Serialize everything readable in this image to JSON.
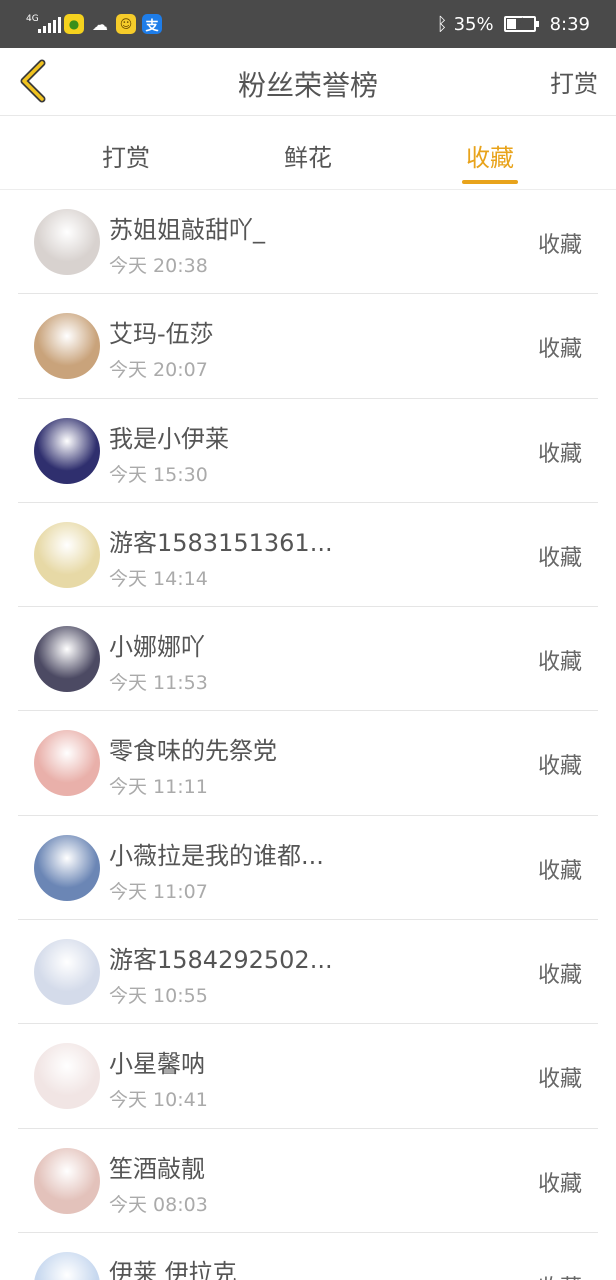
{
  "status_bar": {
    "network": "4G",
    "battery": "35%",
    "battery_level": 0.35,
    "time": "8:39",
    "app_icons": [
      "app-icon",
      "wechat-icon",
      "app-icon",
      "alipay-icon"
    ]
  },
  "header": {
    "title": "粉丝荣誉榜",
    "action": "打赏"
  },
  "tabs": [
    {
      "label": "打赏",
      "active": false
    },
    {
      "label": "鲜花",
      "active": false
    },
    {
      "label": "收藏",
      "active": true
    }
  ],
  "colors": {
    "accent": "#e8a31b",
    "status_bar": "#4a4a4a"
  },
  "fans": [
    {
      "name": "苏姐姐敲甜吖_",
      "time": "今天 20:38",
      "action": "收藏",
      "avatar_color": "#d8d2cf"
    },
    {
      "name": "艾玛-伍莎",
      "time": "今天 20:07",
      "action": "收藏",
      "avatar_color": "#c9a37b"
    },
    {
      "name": "我是小伊莱",
      "time": "今天 15:30",
      "action": "收藏",
      "avatar_color": "#2f2f6e"
    },
    {
      "name": "游客1583151361...",
      "time": "今天 14:14",
      "action": "收藏",
      "avatar_color": "#e7d9a6"
    },
    {
      "name": "小娜娜吖",
      "time": "今天 11:53",
      "action": "收藏",
      "avatar_color": "#4c4a63"
    },
    {
      "name": "零食味的先祭党",
      "time": "今天 11:11",
      "action": "收藏",
      "avatar_color": "#e9b0aa"
    },
    {
      "name": "小薇拉是我的谁都...",
      "time": "今天 11:07",
      "action": "收藏",
      "avatar_color": "#6b86b5"
    },
    {
      "name": "游客1584292502...",
      "time": "今天 10:55",
      "action": "收藏",
      "avatar_color": "#d4dbea"
    },
    {
      "name": "小星馨呐",
      "time": "今天 10:41",
      "action": "收藏",
      "avatar_color": "#f1e5e4"
    },
    {
      "name": "笙酒敲靓",
      "time": "今天 08:03",
      "action": "收藏",
      "avatar_color": "#e3c2bb"
    },
    {
      "name": "伊莱 伊拉克",
      "time": "",
      "action": "收藏",
      "avatar_color": "#c7d8ef"
    }
  ]
}
